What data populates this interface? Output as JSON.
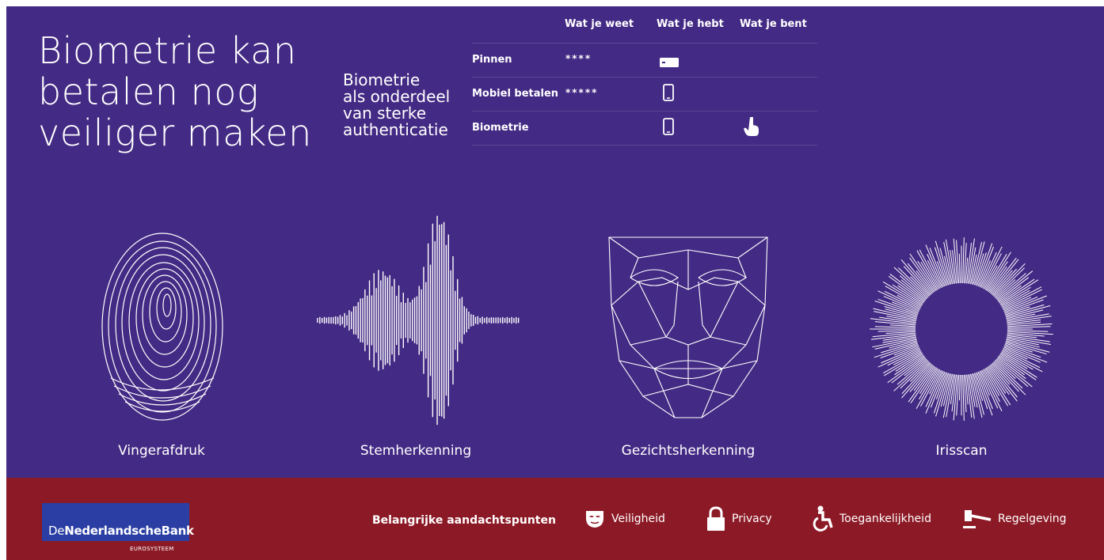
{
  "header": {
    "title_lines": [
      "Biometrie kan",
      "betalen nog",
      "veiliger maken"
    ],
    "subtitle_lines": [
      "Biometrie",
      "als onderdeel",
      "van sterke",
      "authenticatie"
    ]
  },
  "auth_table": {
    "columns": [
      "Wat je weet",
      "Wat je hebt",
      "Wat je bent"
    ],
    "rows": [
      {
        "label": "Pinnen",
        "weet": "****",
        "hebt_icon": "card-icon",
        "bent_icon": ""
      },
      {
        "label": "Mobiel betalen",
        "weet": "*****",
        "hebt_icon": "phone-icon",
        "bent_icon": ""
      },
      {
        "label": "Biometrie",
        "weet": "",
        "hebt_icon": "phone-icon",
        "bent_icon": "finger-touch-icon"
      }
    ]
  },
  "methods": [
    {
      "label": "Vingerafdruk",
      "icon": "fingerprint-icon"
    },
    {
      "label": "Stemherkenning",
      "icon": "soundwave-icon"
    },
    {
      "label": "Gezichtsherkenning",
      "icon": "face-mesh-icon"
    },
    {
      "label": "Irisscan",
      "icon": "iris-icon"
    }
  ],
  "footer": {
    "logo_text_de": "De",
    "logo_text_main": "NederlandscheBank",
    "logo_sub": "EUROSYSTEEM",
    "points_label": "Belangrijke aandachtspunten",
    "points": [
      {
        "label": "Veiligheid",
        "icon": "mask-icon"
      },
      {
        "label": "Privacy",
        "icon": "lock-icon"
      },
      {
        "label": "Toegankelijkheid",
        "icon": "wheelchair-icon"
      },
      {
        "label": "Regelgeving",
        "icon": "gavel-icon"
      }
    ]
  },
  "colors": {
    "top_bg": "#432a84",
    "footer_bg": "#8c1a26",
    "logo_bg": "#2a3ea3"
  }
}
